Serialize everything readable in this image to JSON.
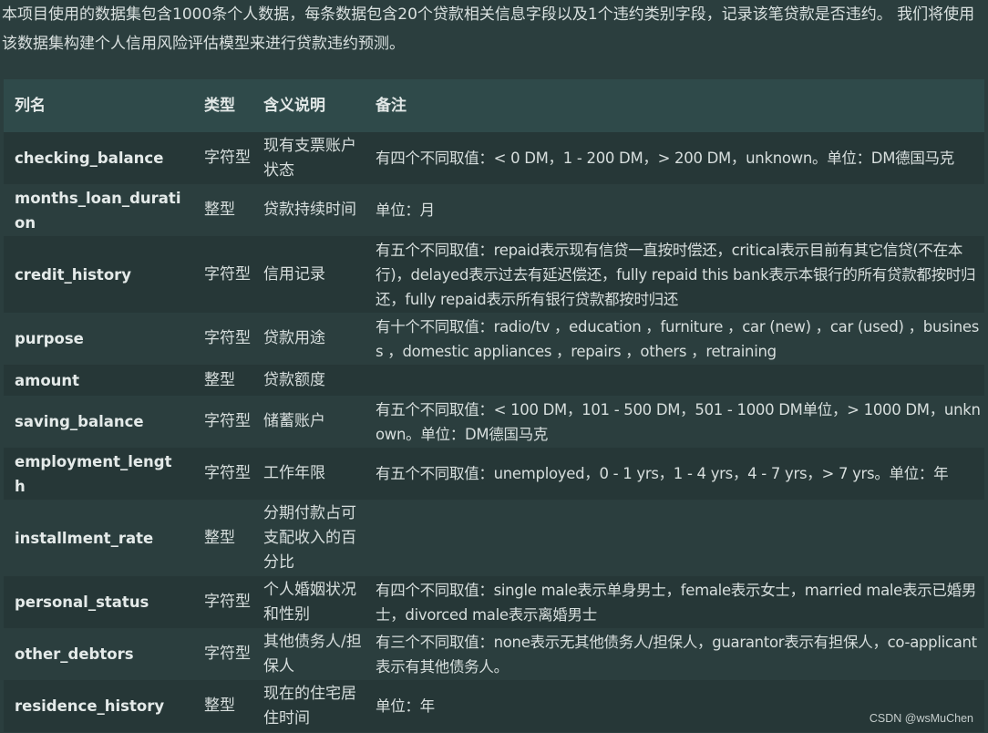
{
  "intro": "本项目使用的数据集包含1000条个人数据，每条数据包含20个贷款相关信息字段以及1个违约类别字段，记录该笔贷款是否违约。 我们将使用该数据集构建个人信用风险评估模型来进行贷款违约预测。",
  "table": {
    "headers": [
      "列名",
      "类型",
      "含义说明",
      "备注"
    ],
    "rows": [
      {
        "name": "checking_balance",
        "type": "字符型",
        "meaning": "现有支票账户状态",
        "notes": "有四个不同取值：< 0 DM，1 - 200 DM，> 200 DM，unknown。单位：DM德国马克"
      },
      {
        "name": "months_loan_duration",
        "type": "整型",
        "meaning": "贷款持续时间",
        "notes": "单位：月"
      },
      {
        "name": "credit_history",
        "type": "字符型",
        "meaning": "信用记录",
        "notes": "有五个不同取值：repaid表示现有信贷一直按时偿还，critical表示目前有其它信贷(不在本行)，delayed表示过去有延迟偿还，fully repaid this bank表示本银行的所有贷款都按时归还，fully repaid表示所有银行贷款都按时归还"
      },
      {
        "name": "purpose",
        "type": "字符型",
        "meaning": "贷款用途",
        "notes": "有十个不同取值：radio/tv ，education ，furniture ，car (new) ，car (used) ，business ，domestic appliances ，repairs ，others ，retraining"
      },
      {
        "name": "amount",
        "type": "整型",
        "meaning": "贷款额度",
        "notes": ""
      },
      {
        "name": "saving_balance",
        "type": "字符型",
        "meaning": "储蓄账户",
        "notes": "有五个不同取值：< 100 DM，101 - 500 DM，501 - 1000 DM单位，> 1000 DM，unknown。单位：DM德国马克"
      },
      {
        "name": "employment_length",
        "type": "字符型",
        "meaning": "工作年限",
        "notes": "有五个不同取值：unemployed，0 - 1 yrs，1 - 4 yrs，4 - 7 yrs，> 7 yrs。单位：年"
      },
      {
        "name": "installment_rate",
        "type": "整型",
        "meaning": "分期付款占可支配收入的百分比",
        "notes": ""
      },
      {
        "name": "personal_status",
        "type": "字符型",
        "meaning": "个人婚姻状况和性别",
        "notes": "有四个不同取值：single male表示单身男士，female表示女士，married male表示已婚男士，divorced male表示离婚男士"
      },
      {
        "name": "other_debtors",
        "type": "字符型",
        "meaning": "其他债务人/担保人",
        "notes": "有三个不同取值：none表示无其他债务人/担保人，guarantor表示有担保人，co-applicant表示有其他债务人。"
      },
      {
        "name": "residence_history",
        "type": "整型",
        "meaning": "现在的住宅居住时间",
        "notes": "单位：年"
      }
    ]
  },
  "watermark": "CSDN @wsMuChen"
}
